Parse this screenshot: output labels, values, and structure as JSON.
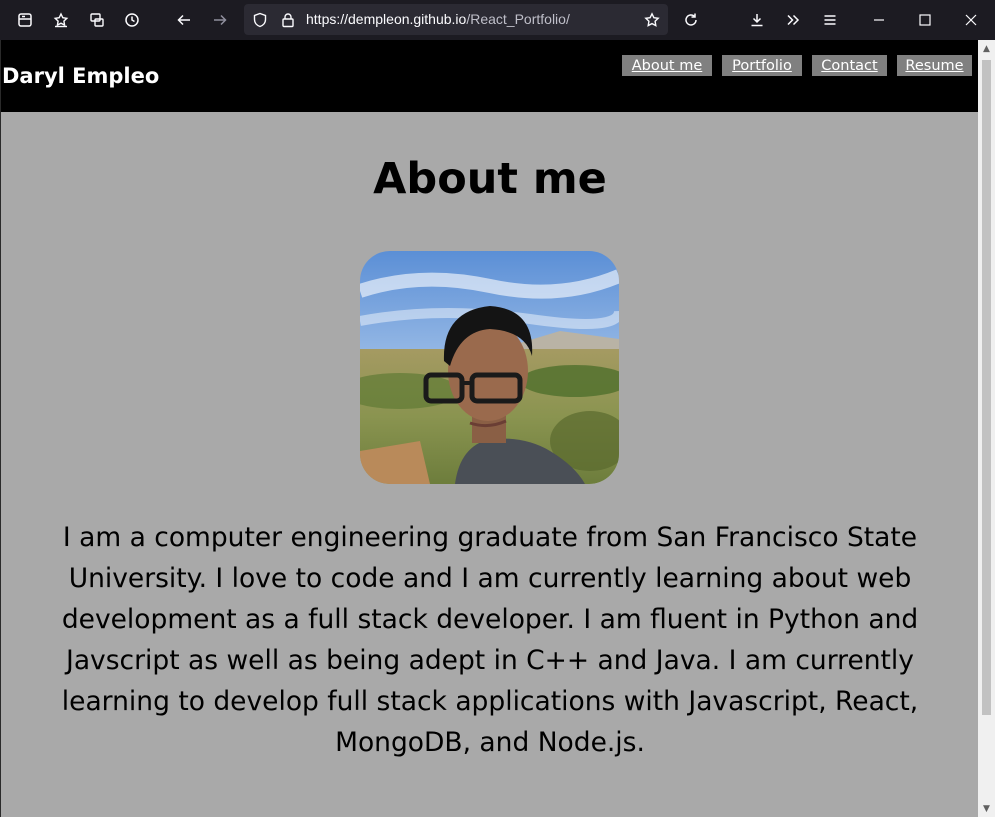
{
  "browser": {
    "url_host": "https://dempleon.github.io",
    "url_path": "/React_Portfolio/",
    "icons": [
      "sidebar-icon",
      "bookmarks-icon",
      "synced-tabs-icon",
      "history-icon",
      "back-icon",
      "forward-icon",
      "shield-icon",
      "lock-icon",
      "star-icon",
      "reload-icon",
      "download-icon",
      "overflow-icon",
      "menu-icon",
      "minimize-icon",
      "maximize-icon",
      "close-icon"
    ]
  },
  "header": {
    "brand": "Daryl Empleo",
    "nav": [
      "About me",
      "Portfolio",
      "Contact",
      "Resume"
    ]
  },
  "main": {
    "title": "About me",
    "bio": "I am a computer engineering graduate from San Francisco State University. I love to code and I am currently learning about web development as a full stack developer. I am fluent in Python and Javscript as well as being adept in C++ and Java. I am currently learning to develop full stack applications with Javascript, React, MongoDB, and Node.js."
  },
  "colors": {
    "header_bg": "#000000",
    "page_bg": "#a9a9a9",
    "nav_bg": "#808080",
    "chrome_bg": "#1c1b22"
  }
}
